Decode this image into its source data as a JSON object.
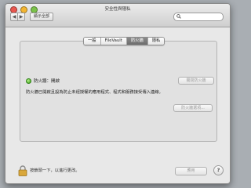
{
  "window": {
    "title": "安全性與隱私"
  },
  "toolbar": {
    "back_glyph": "◀",
    "forward_glyph": "▶",
    "show_all_label": "顯示全部",
    "search": {
      "placeholder": "",
      "value": "",
      "icon": "search-icon"
    }
  },
  "tabs": [
    {
      "label": "一般",
      "selected": false
    },
    {
      "label": "FileVault",
      "selected": false
    },
    {
      "label": "防火牆",
      "selected": true
    },
    {
      "label": "隱私",
      "selected": false
    }
  ],
  "firewall": {
    "status_label": "防火牆：開啟",
    "status_color": "#3aa117",
    "description": "防火牆已開啟且設為防止未經授權的應用程式、程式和服務接受傳入連線。",
    "stop_button": "關閉防火牆",
    "advanced_button": "防火牆選項..."
  },
  "footer": {
    "lock_text": "按鎖頭一下，以進行更改。",
    "apply_button": "應用",
    "help_glyph": "?"
  }
}
